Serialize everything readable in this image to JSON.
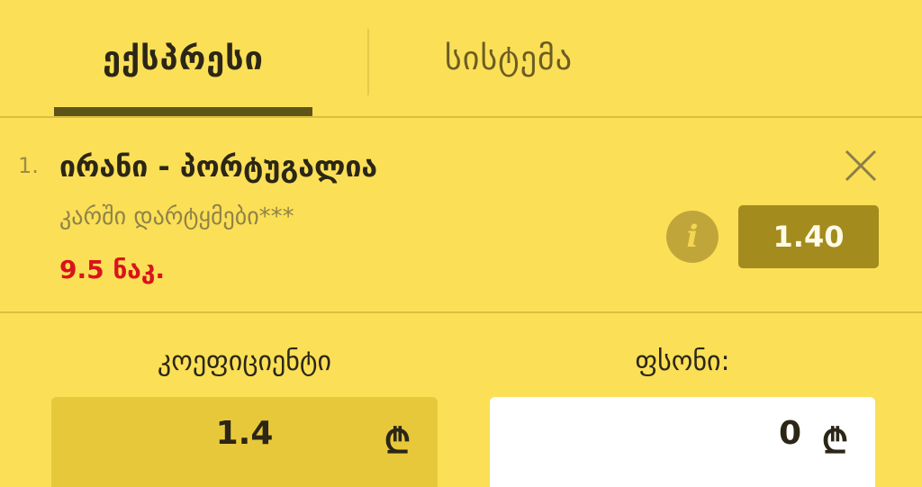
{
  "tabs": {
    "express": "ექსპრესი",
    "system": "სისტემა"
  },
  "bet": {
    "index": "1.",
    "match": "ირანი - პორტუგალია",
    "market": "კარში დარტყმები***",
    "stake_label": "9.5 ნაკ.",
    "odds": "1.40",
    "info_glyph": "i"
  },
  "fields": {
    "coefficient_label": "კოეფიციენტი",
    "coefficient_value": "1.4",
    "stake_label": "ფსონი:",
    "stake_value": "0",
    "currency_symbol": "₾"
  },
  "colors": {
    "background": "#fbdf56",
    "accent_dark": "#a38b1e",
    "stake_red": "#d9131b"
  },
  "icons": {
    "close": "close-icon",
    "info": "info-icon",
    "currency": "lari-icon"
  }
}
